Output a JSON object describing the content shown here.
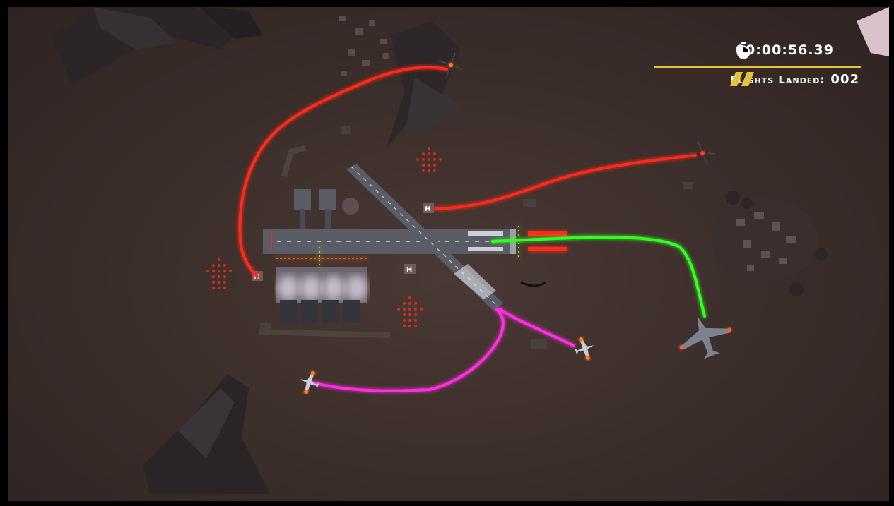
{
  "hud": {
    "timer_icon": "stopwatch-icon",
    "timer": "00:00:56.39",
    "landed_icon": "runway-stripes-icon",
    "flights_landed_label": "Flights Landed:",
    "flights_landed_count": "002",
    "accent_color": "#e6c13a"
  },
  "routes": {
    "helicopter_color": "#ff2a1a",
    "jet_color": "#33ff22",
    "prop_color": "#ff2ee0"
  },
  "colors": {
    "ground": "#3d2f2b",
    "runway": "#5a5d66",
    "rocks": "#2a2426"
  }
}
